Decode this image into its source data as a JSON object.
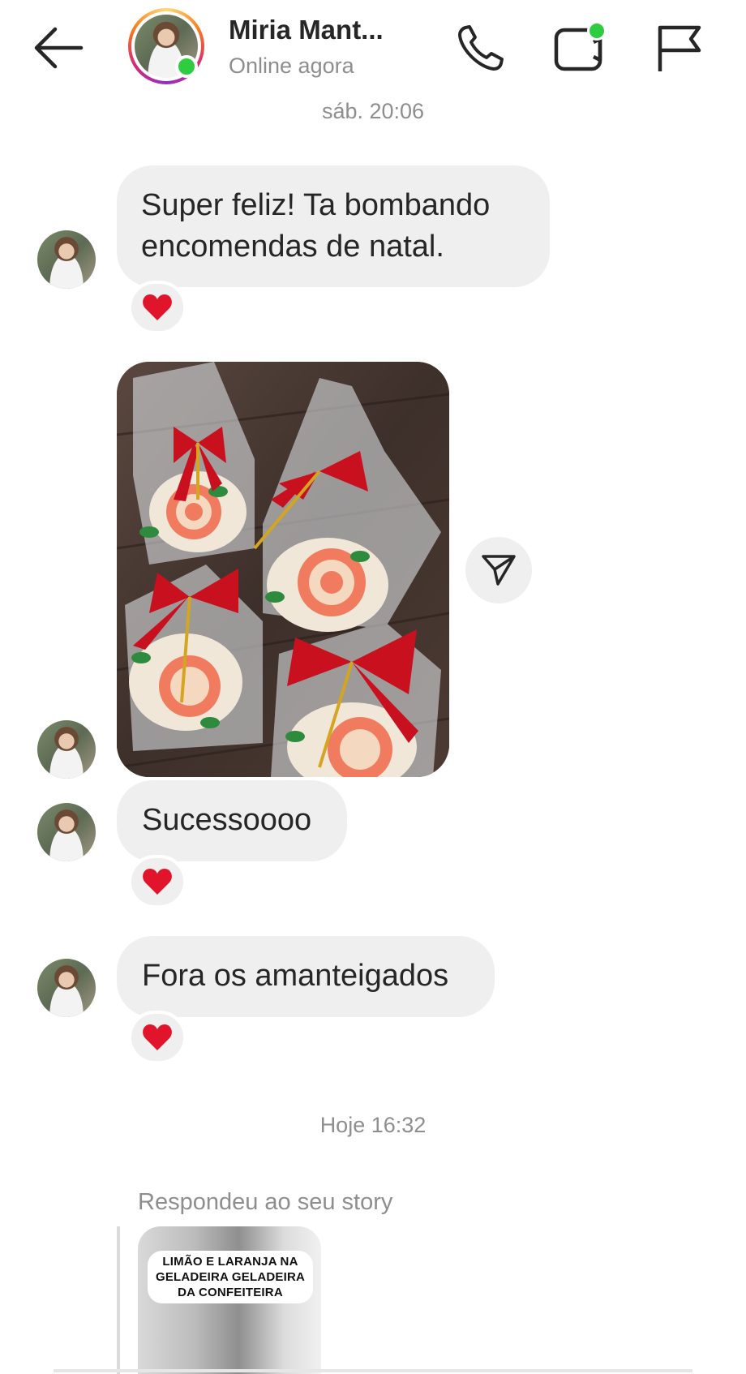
{
  "header": {
    "back_label": "",
    "contact_name": "Miria Mant...",
    "status": "Online agora",
    "online": true
  },
  "timestamps": {
    "top": "sáb. 20:06",
    "middle": "Hoje 16:32"
  },
  "messages": [
    {
      "type": "text",
      "text": "Super feliz! Ta bombando encomendas de natal.",
      "reaction": "❤️"
    },
    {
      "type": "photo",
      "description_icon": "christmas-cookies-photo"
    },
    {
      "type": "text",
      "text": "Sucessoooo",
      "reaction": "❤️"
    },
    {
      "type": "text",
      "text": "Fora os amanteigados",
      "reaction": "❤️"
    }
  ],
  "story_reply": {
    "label": "Respondeu ao seu story",
    "caption": "LIMÃO E LARANJA NA GELADEIRA GELADEIRA DA CONFEITEIRA"
  },
  "colors": {
    "bubble": "#efefef",
    "online": "#2ecc40",
    "muted_text": "#8e8e8e",
    "heart": "#e0142b"
  },
  "icons": [
    "back-arrow-icon",
    "phone-icon",
    "video-icon",
    "flag-icon",
    "send-icon",
    "heart-icon"
  ]
}
